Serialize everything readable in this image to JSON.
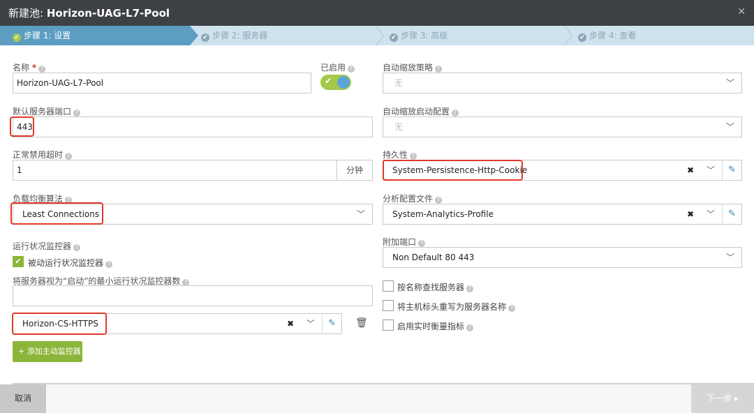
{
  "title": {
    "prefix": "新建池:",
    "name": "Horizon-UAG-L7-Pool"
  },
  "steps": [
    {
      "label": "步骤 1: 设置"
    },
    {
      "label": "步骤 2: 服务器"
    },
    {
      "label": "步骤 3: 高级"
    },
    {
      "label": "步骤 4: 查看"
    }
  ],
  "left": {
    "name_label": "名称",
    "name_value": "Horizon-UAG-L7-Pool",
    "enabled_label": "已启用",
    "port_label": "默认服务器端口",
    "port_value": "443",
    "timeout_label": "正常禁用超时",
    "timeout_value": "1",
    "timeout_unit": "分钟",
    "algo_label": "负载均衡算法",
    "algo_value": "Least Connections",
    "monitor_label": "运行状况监控器",
    "passive_label": "被动运行状况监控器",
    "min_monitor_label": "将服务器视为“启动”的最小运行状况监控器数",
    "min_monitor_value": "",
    "monitor_value": "Horizon-CS-HTTPS",
    "add_monitor_label": "添加主动监控器"
  },
  "right": {
    "autoscale_policy_label": "自动缩放策略",
    "autoscale_policy_value": "无",
    "autoscale_launch_label": "自动缩放启动配置",
    "autoscale_launch_value": "无",
    "persistence_label": "持久性",
    "persistence_value": "System-Persistence-Http-Cookie",
    "analytics_label": "分析配置文件",
    "analytics_value": "System-Analytics-Profile",
    "extra_port_label": "附加端口",
    "extra_port_value": "Non Default 80 443",
    "cb1": "按名称查找服务器",
    "cb2": "将主机标头重写为服务器名称",
    "cb3": "启用实时衡量指标"
  },
  "footer": {
    "cancel": "取消",
    "next": "下一步"
  },
  "colors": {
    "accent_green": "#8bb63a",
    "step_active": "#5b9ec2",
    "highlight": "#e0382a"
  }
}
